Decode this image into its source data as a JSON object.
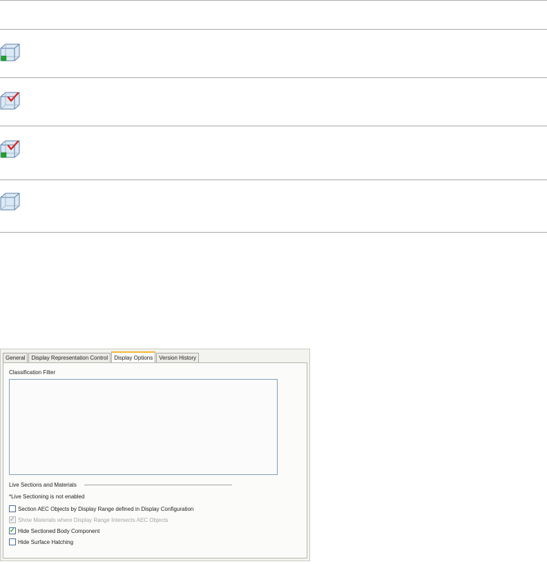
{
  "icons": [
    "cube-green-square-icon",
    "cube-red-check-icon",
    "cube-green-red-check-icon",
    "cube-plain-icon"
  ],
  "dialog": {
    "tabs": [
      {
        "label": "General",
        "active": false
      },
      {
        "label": "Display Representation Control",
        "active": false
      },
      {
        "label": "Display Options",
        "active": true
      },
      {
        "label": "Version History",
        "active": false
      }
    ],
    "classification_filter_label": "Classification Filter",
    "live_sections_label": "Live Sections and Materials",
    "live_sectioning_note": "*Live Sectioning is not enabled",
    "options": [
      {
        "label": "Section AEC Objects by Display Range defined in Display Configuration",
        "checked": false,
        "enabled": true
      },
      {
        "label": "Show Materials where Display Range Intersects AEC Objects",
        "checked": true,
        "enabled": false
      },
      {
        "label": "Hide Sectioned Body Component",
        "checked": true,
        "enabled": true
      },
      {
        "label": "Hide Surface Hatching",
        "checked": false,
        "enabled": true
      }
    ]
  }
}
